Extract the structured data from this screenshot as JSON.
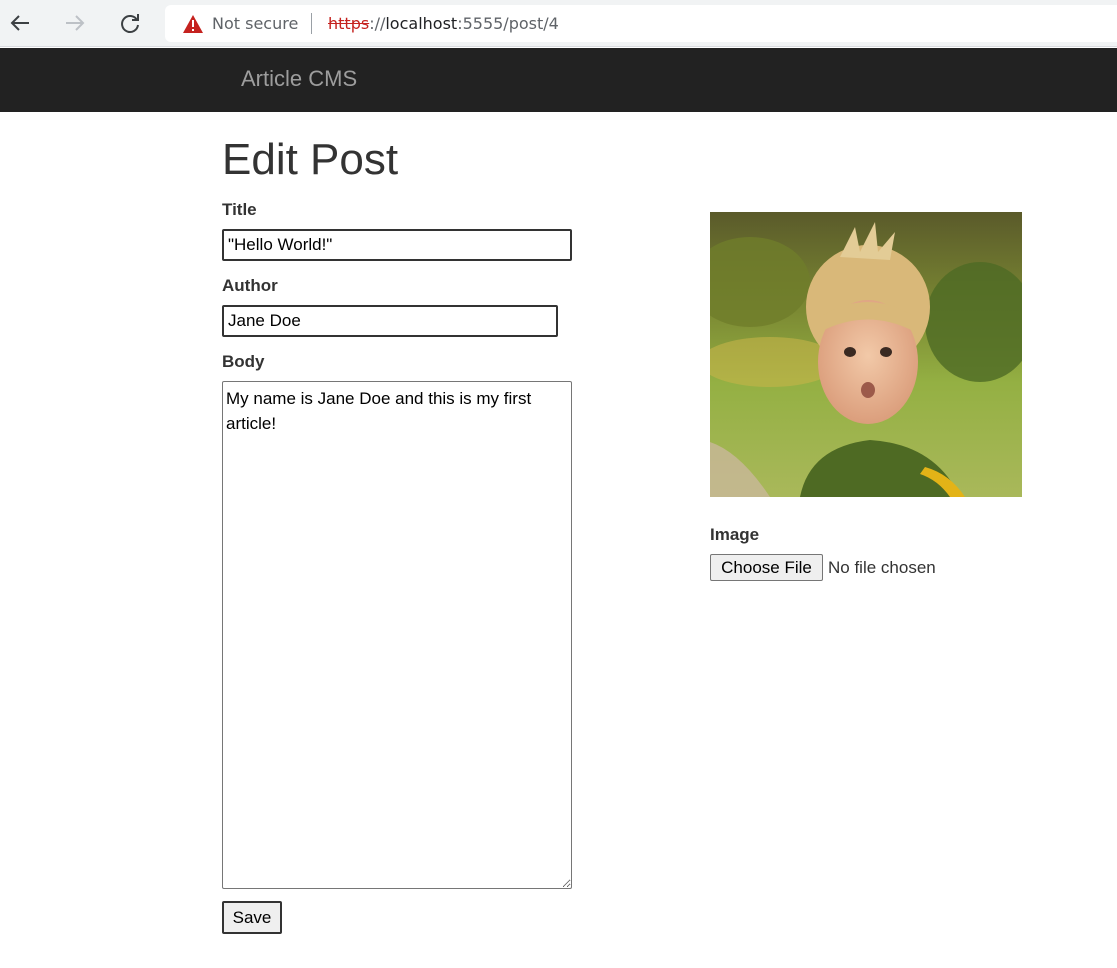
{
  "browser": {
    "security_label": "Not secure",
    "url_scheme": "https",
    "url_after_scheme": "://",
    "url_host": "localhost",
    "url_path": ":5555/post/4"
  },
  "navbar": {
    "brand": "Article CMS"
  },
  "form": {
    "heading": "Edit Post",
    "title_label": "Title",
    "title_value": "\"Hello World!\"",
    "author_label": "Author",
    "author_value": "Jane Doe",
    "body_label": "Body",
    "body_value": "My name is Jane Doe and this is my first article!",
    "image_label": "Image",
    "choose_file_label": "Choose File",
    "file_status": "No file chosen",
    "save_label": "Save"
  },
  "colors": {
    "navbar_bg": "#222222",
    "brand_text": "#9d9d9d",
    "warning_red": "#c5221f"
  },
  "icons": {
    "back": "arrow-left-icon",
    "forward": "arrow-right-icon",
    "reload": "reload-icon",
    "security": "warning-triangle-icon"
  }
}
